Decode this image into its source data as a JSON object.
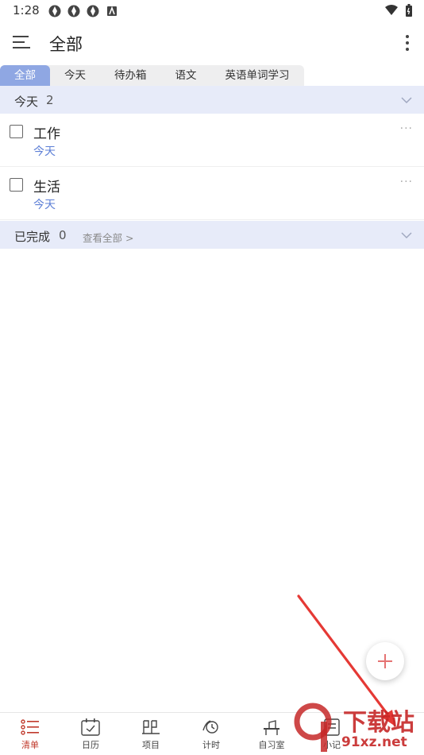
{
  "status_bar": {
    "time": "1:28",
    "icons": [
      "app-icon",
      "app-icon",
      "app-icon",
      "keyboard-icon"
    ],
    "right_icons": [
      "wifi-icon",
      "battery-icon"
    ]
  },
  "header": {
    "title": "全部"
  },
  "tabs": [
    {
      "label": "全部",
      "active": true
    },
    {
      "label": "今天",
      "active": false
    },
    {
      "label": "待办箱",
      "active": false
    },
    {
      "label": "语文",
      "active": false
    },
    {
      "label": "英语单词学习",
      "active": false
    }
  ],
  "sections": {
    "today": {
      "title": "今天",
      "count": "2"
    },
    "done": {
      "title": "已完成",
      "count": "0",
      "view_all": "查看全部 >"
    }
  },
  "tasks": [
    {
      "title": "工作",
      "due": "今天",
      "more": "···"
    },
    {
      "title": "生活",
      "due": "今天",
      "more": "···"
    }
  ],
  "bottom_nav": [
    {
      "label": "清单",
      "icon": "list-icon",
      "active": true
    },
    {
      "label": "日历",
      "icon": "calendar-icon",
      "active": false
    },
    {
      "label": "项目",
      "icon": "project-icon",
      "active": false
    },
    {
      "label": "计时",
      "icon": "timer-icon",
      "active": false
    },
    {
      "label": "自习室",
      "icon": "study-room-icon",
      "active": false
    },
    {
      "label": "小记",
      "icon": "note-icon",
      "active": false
    }
  ],
  "watermark": {
    "text": "下载站",
    "url": "91xz.net"
  },
  "colors": {
    "accent": "#8fa7e3",
    "section_bg": "#e7ebf9",
    "due": "#5d7fd6",
    "active_nav": "#c0392b",
    "arrow": "#e53935"
  }
}
